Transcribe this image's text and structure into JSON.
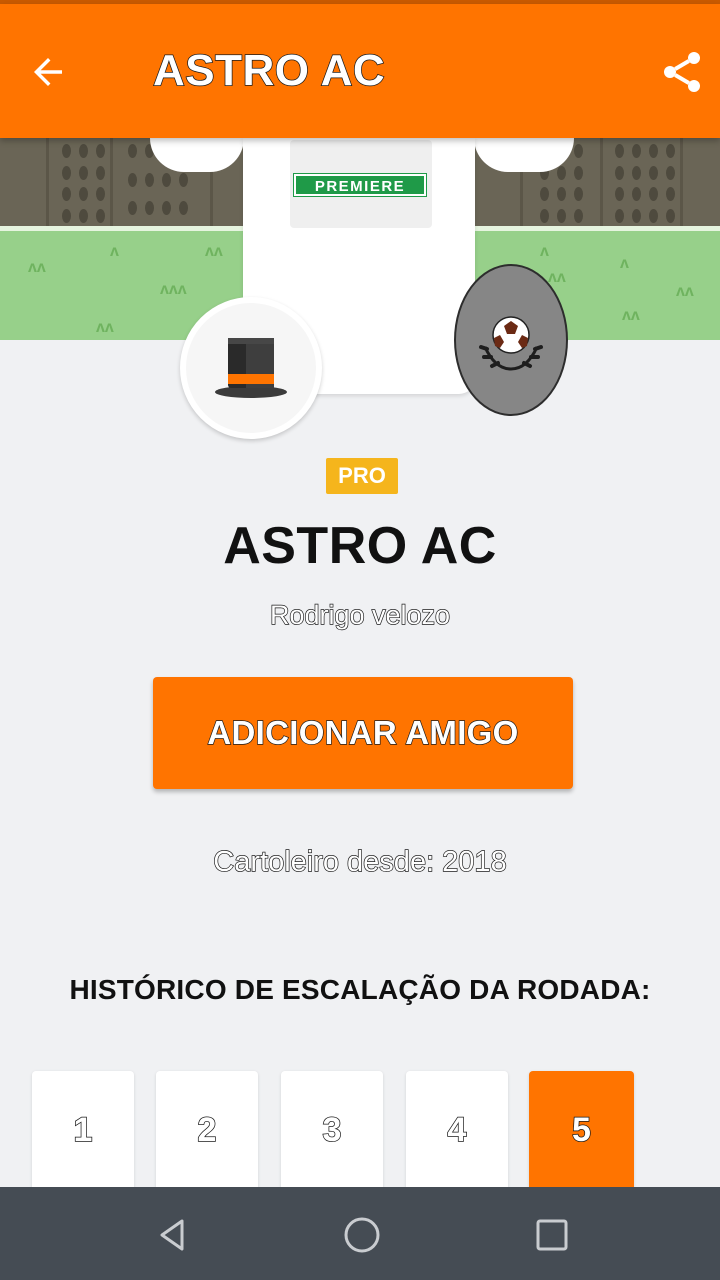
{
  "app_bar": {
    "title": "ASTRO AC",
    "back_icon": "arrow-left-icon",
    "share_icon": "share-icon",
    "color": "#ff7400"
  },
  "jersey": {
    "sponsor": "PREMIERE",
    "sponsor_color": "#1f9a48"
  },
  "avatar_icon": "top-hat-icon",
  "shield_icon": "soccer-ball-laurel-icon",
  "profile": {
    "tag": "PRO",
    "team_name": "ASTRO AC",
    "owner_name": "Rodrigo velozo",
    "add_friend_label": "ADICIONAR AMIGO",
    "since": "Cartoleiro desde: 2018"
  },
  "history": {
    "title": "HISTÓRICO DE ESCALAÇÃO DA RODADA:",
    "rounds": [
      "1",
      "2",
      "3",
      "4",
      "5"
    ],
    "active_round": "5"
  },
  "system_nav": {
    "back_icon": "triangle-back-icon",
    "home_icon": "circle-home-icon",
    "recents_icon": "square-recents-icon",
    "color": "#454c54"
  }
}
